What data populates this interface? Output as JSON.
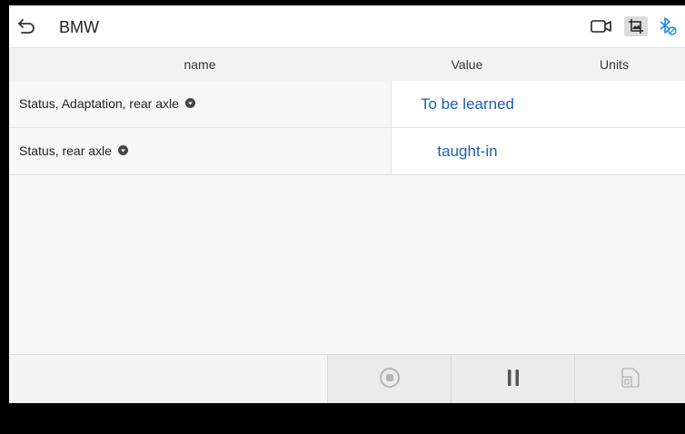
{
  "header": {
    "title": "BMW",
    "back_icon": "back-arrow-icon",
    "icons": [
      "video-record-icon",
      "screenshot-icon",
      "bluetooth-icon"
    ]
  },
  "table": {
    "columns": [
      "name",
      "Value",
      "Units"
    ],
    "rows": [
      {
        "name": "Status, Adaptation, rear axle",
        "value": "To be learned",
        "units": ""
      },
      {
        "name": "Status, rear axle",
        "value": "taught-in",
        "units": ""
      }
    ]
  },
  "toolbar": {
    "buttons": [
      "stop-icon",
      "pause-icon",
      "save-icon"
    ]
  },
  "colors": {
    "value_text": "#1f5fb0",
    "bluetooth": "#1e88e5",
    "background": "#f7f7f7"
  }
}
